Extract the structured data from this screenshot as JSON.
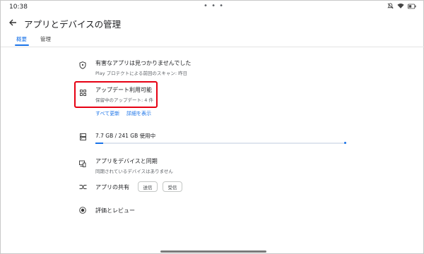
{
  "status_bar": {
    "time": "10:38",
    "menu_dots": "• • •",
    "icons": [
      "notifications-off-icon",
      "wifi-icon",
      "battery-icon"
    ]
  },
  "app_bar": {
    "title": "アプリとデバイスの管理",
    "back_icon": "arrow-back-icon"
  },
  "tabs": [
    {
      "label": "概要",
      "active": true
    },
    {
      "label": "管理",
      "active": false
    }
  ],
  "overview": {
    "protect": {
      "icon": "shield-icon",
      "title": "有害なアプリは見つかりませんでした",
      "subtitle": "Play プロテクトによる前回のスキャン: 昨日"
    },
    "updates": {
      "icon": "apps-grid-icon",
      "title": "アップデート利用可能",
      "subtitle": "保留中のアップデート: 4 件",
      "update_all_label": "すべて更新",
      "details_label": "詳細を表示"
    },
    "storage": {
      "icon": "storage-icon",
      "label": "7.7 GB / 241 GB 使用中",
      "used_fraction": 0.032
    },
    "sync": {
      "icon": "devices-sync-icon",
      "title": "アプリをデバイスと同期",
      "subtitle": "同期されているデバイスはありません"
    },
    "share": {
      "icon": "share-arrows-icon",
      "title": "アプリの共有",
      "send_label": "送信",
      "receive_label": "受信"
    },
    "ratings": {
      "icon": "ratings-icon",
      "title": "評価とレビュー"
    }
  },
  "colors": {
    "accent": "#1a73e8",
    "highlight": "#e60012"
  }
}
